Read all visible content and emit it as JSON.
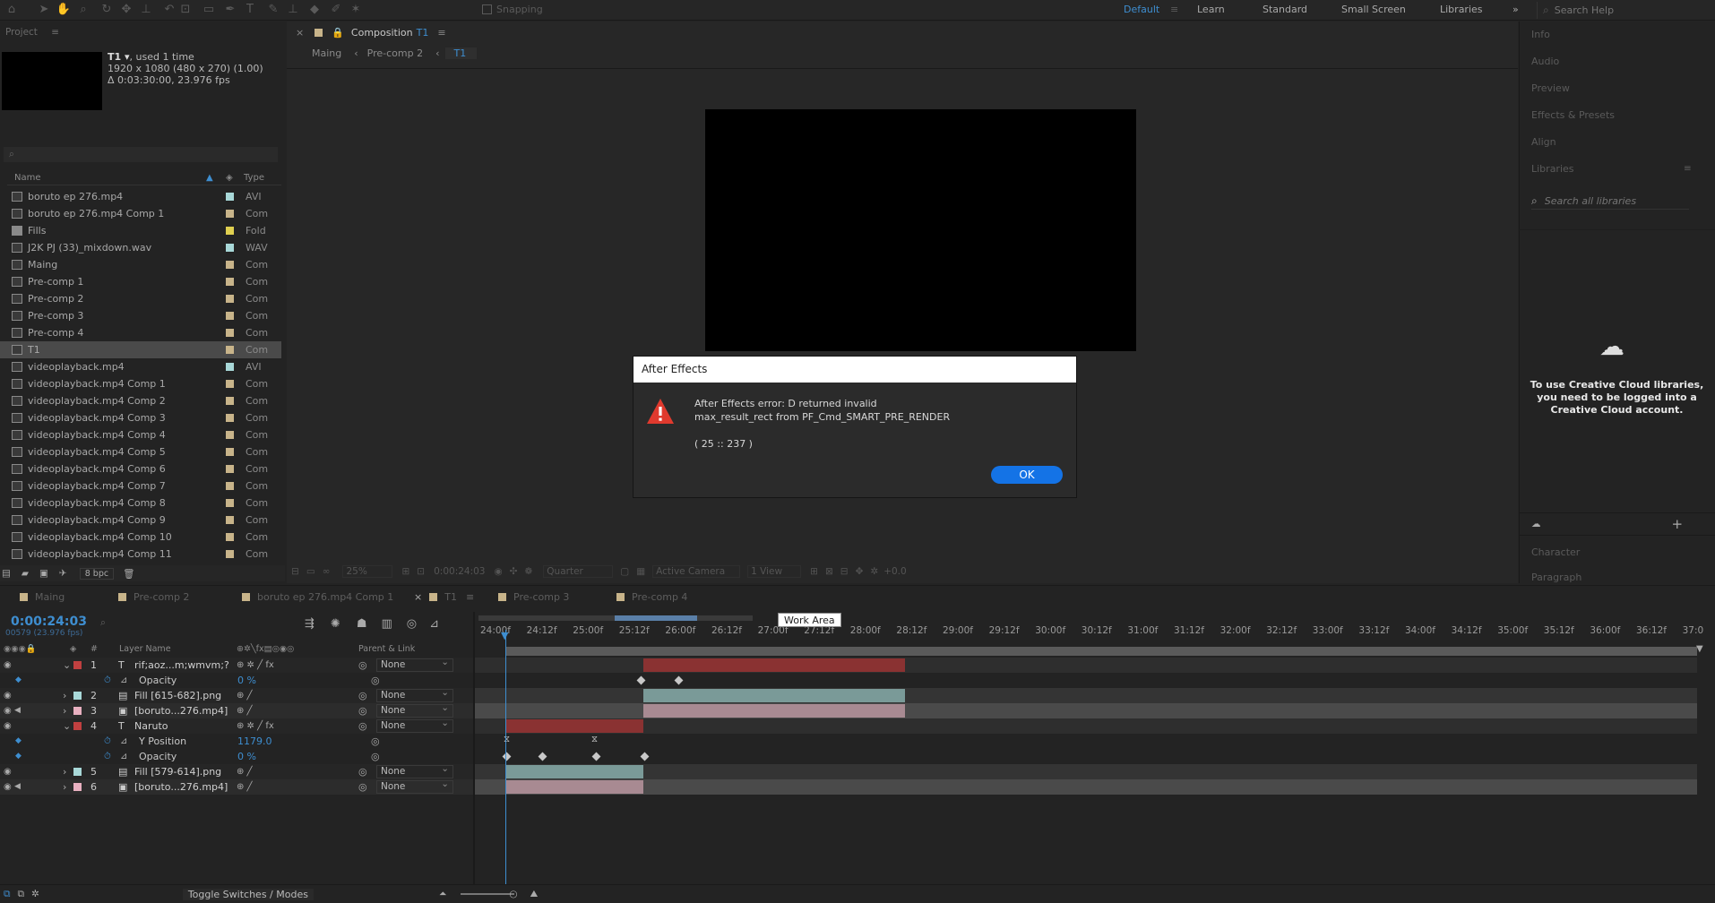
{
  "toolbar": {
    "snapping": "Snapping",
    "search_placeholder": "Search Help"
  },
  "workspaces": [
    {
      "label": "Default",
      "active": true
    },
    {
      "label": "Learn",
      "active": false
    },
    {
      "label": "Standard",
      "active": false
    },
    {
      "label": "Small Screen",
      "active": false
    },
    {
      "label": "Libraries",
      "active": false
    }
  ],
  "project": {
    "title": "Project",
    "item_name": "T1 ▾",
    "used": ", used 1 time",
    "dims": "1920 x 1080  (480 x 270) (1.00)",
    "duration": "Δ 0:03:30:00, 23.976 fps",
    "search_placeholder": "⌕",
    "col_name": "Name",
    "col_type": "Type",
    "bpc": "8 bpc",
    "items": [
      {
        "name": "boruto ep 276.mp4",
        "type": "AVI",
        "color": "#a8d8d8"
      },
      {
        "name": "boruto ep 276.mp4 Comp 1",
        "type": "Com",
        "color": "#c8b48a"
      },
      {
        "name": "Fills",
        "type": "Fold",
        "color": "#e0d050"
      },
      {
        "name": "J2K PJ (33)_mixdown.wav",
        "type": "WAV",
        "color": "#a8d8d8"
      },
      {
        "name": "Maing",
        "type": "Com",
        "color": "#c8b48a"
      },
      {
        "name": "Pre-comp 1",
        "type": "Com",
        "color": "#c8b48a"
      },
      {
        "name": "Pre-comp 2",
        "type": "Com",
        "color": "#c8b48a"
      },
      {
        "name": "Pre-comp 3",
        "type": "Com",
        "color": "#c8b48a"
      },
      {
        "name": "Pre-comp 4",
        "type": "Com",
        "color": "#c8b48a"
      },
      {
        "name": "T1",
        "type": "Com",
        "color": "#c8b48a",
        "selected": true
      },
      {
        "name": "videoplayback.mp4",
        "type": "AVI",
        "color": "#a8d8d8"
      },
      {
        "name": "videoplayback.mp4 Comp 1",
        "type": "Com",
        "color": "#c8b48a"
      },
      {
        "name": "videoplayback.mp4 Comp 2",
        "type": "Com",
        "color": "#c8b48a"
      },
      {
        "name": "videoplayback.mp4 Comp 3",
        "type": "Com",
        "color": "#c8b48a"
      },
      {
        "name": "videoplayback.mp4 Comp 4",
        "type": "Com",
        "color": "#c8b48a"
      },
      {
        "name": "videoplayback.mp4 Comp 5",
        "type": "Com",
        "color": "#c8b48a"
      },
      {
        "name": "videoplayback.mp4 Comp 6",
        "type": "Com",
        "color": "#c8b48a"
      },
      {
        "name": "videoplayback.mp4 Comp 7",
        "type": "Com",
        "color": "#c8b48a"
      },
      {
        "name": "videoplayback.mp4 Comp 8",
        "type": "Com",
        "color": "#c8b48a"
      },
      {
        "name": "videoplayback.mp4 Comp 9",
        "type": "Com",
        "color": "#c8b48a"
      },
      {
        "name": "videoplayback.mp4 Comp 10",
        "type": "Com",
        "color": "#c8b48a"
      },
      {
        "name": "videoplayback.mp4 Comp 11",
        "type": "Com",
        "color": "#c8b48a"
      }
    ]
  },
  "composition": {
    "tab_label": "Composition",
    "tab_name": "T1",
    "breadcrumbs": [
      "Maing",
      "Pre-comp 2",
      "T1"
    ],
    "zoom": "25%",
    "time": "0:00:24:03",
    "resolution": "Quarter",
    "camera": "Active Camera",
    "views": "1 View",
    "exposure": "+0.0"
  },
  "right_panel": {
    "items": [
      "Info",
      "Audio",
      "Preview",
      "Effects & Presets",
      "Align",
      "Libraries"
    ],
    "search_placeholder": "Search all libraries",
    "cc_message": "To use Creative Cloud libraries, you need to be logged into a Creative Cloud account.",
    "bottom_items": [
      "Character",
      "Paragraph"
    ]
  },
  "dialog": {
    "title": "After Effects",
    "message": "After Effects error: D returned invalid max_result_rect from PF_Cmd_SMART_PRE_RENDER",
    "code": "( 25 :: 237 )",
    "ok": "OK"
  },
  "timeline": {
    "tabs": [
      {
        "label": "Maing",
        "color": "#c8b48a"
      },
      {
        "label": "Pre-comp 2",
        "color": "#c8b48a"
      },
      {
        "label": "boruto ep 276.mp4 Comp 1",
        "color": "#c8b48a"
      },
      {
        "label": "T1",
        "color": "#c8b48a",
        "active": true
      },
      {
        "label": "Pre-comp 3",
        "color": "#c8b48a"
      },
      {
        "label": "Pre-comp 4",
        "color": "#c8b48a"
      }
    ],
    "current_time": "0:00:24:03",
    "frame_info": "00579 (23.976 fps)",
    "search_placeholder": "⌕",
    "col_layer_name": "Layer Name",
    "col_parent": "Parent & Link",
    "work_area_tooltip": "Work Area",
    "toggle_label": "Toggle Switches / Modes",
    "ruler": [
      "24:00f",
      "24:12f",
      "25:00f",
      "25:12f",
      "26:00f",
      "26:12f",
      "27:00f",
      "27:12f",
      "28:00f",
      "28:12f",
      "29:00f",
      "29:12f",
      "30:00f",
      "30:12f",
      "31:00f",
      "31:12f",
      "32:00f",
      "32:12f",
      "33:00f",
      "33:12f",
      "34:00f",
      "34:12f",
      "35:00f",
      "35:12f",
      "36:00f",
      "36:12f",
      "37:0"
    ],
    "layers": [
      {
        "num": "1",
        "name": "rif;aoz...m;wmvm;?",
        "kind": "T",
        "color": "#c04040",
        "parent": "None"
      },
      {
        "prop": "Opacity",
        "value": "0 %"
      },
      {
        "num": "2",
        "name": "Fill [615-682].png",
        "kind": "img",
        "color": "#a8d8d8",
        "parent": "None"
      },
      {
        "num": "3",
        "name": "[boruto...276.mp4]",
        "kind": "vid",
        "color": "#e8b0c0",
        "parent": "None"
      },
      {
        "num": "4",
        "name": "Naruto",
        "kind": "T",
        "color": "#c04040",
        "parent": "None"
      },
      {
        "prop": "Y Position",
        "value": "1179.0"
      },
      {
        "prop": "Opacity",
        "value": "0 %"
      },
      {
        "num": "5",
        "name": "Fill [579-614].png",
        "kind": "img",
        "color": "#a8d8d8",
        "parent": "None"
      },
      {
        "num": "6",
        "name": "[boruto...276.mp4]",
        "kind": "vid",
        "color": "#e8b0c0",
        "parent": "None"
      }
    ]
  }
}
